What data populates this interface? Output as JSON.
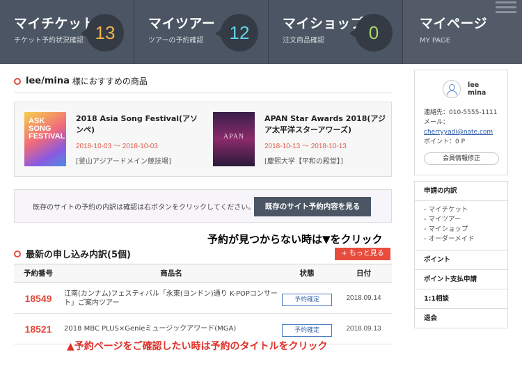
{
  "nav": [
    {
      "title": "マイチケット",
      "sub": "チケット予約状況確認",
      "count": "13"
    },
    {
      "title": "マイツアー",
      "sub": "ツアーの予約確認",
      "count": "12"
    },
    {
      "title": "マイショップ",
      "sub": "注文商品確認",
      "count": "0"
    },
    {
      "title": "マイページ",
      "sub": "MY PAGE"
    }
  ],
  "recommend": {
    "user": "lee/mina",
    "suffix": "様におすすめの商品",
    "items": [
      {
        "poster_text": "ASK SONG FESTIVAL",
        "name": "2018 Asia Song Festival(アソンペ)",
        "date": "2018-10-03 ～ 2018-10-03",
        "venue": "[釜山アジアードメイン競技場]"
      },
      {
        "poster_text": "APAN",
        "name": "APAN Star Awards 2018(アジア太平洋スターアワーズ)",
        "date": "2018-10-13 ～ 2018-10-13",
        "venue": "[慶熙大学【平和の殿堂】]"
      }
    ]
  },
  "notice": {
    "text": "既存のサイトの予約の内訳は確認は右ボタンをクリックしてください。",
    "button": "既存のサイト予約内容を見る"
  },
  "annotation_top": "予約が見つからない時は▼をクリック",
  "recent": {
    "title": "最新の申し込み内訳(5個)",
    "more": "+ もっと見る",
    "headers": [
      "予約番号",
      "商品名",
      "状態",
      "日付"
    ],
    "rows": [
      {
        "no": "18549",
        "title": "江南(カンナム)フェスティバル「永東(ヨンドン)通り K-POPコンサート」ご案内ツアー",
        "status": "予約確定",
        "date": "2018.09.14"
      },
      {
        "no": "18521",
        "title": "2018 MBC PLUS×Genieミュージックアワード(MGA)",
        "status": "予約確定",
        "date": "2018.09.13"
      }
    ]
  },
  "annotation_bottom": "▲予約ページをご確認したい時は予約のタイトルをクリック",
  "profile": {
    "name_line1": "lee",
    "name_line2": "mina",
    "phone": "連絡先：010-5555-1111",
    "mail_label": "メール：",
    "email": "cherryyadi@nate.com",
    "points": "ポイント：0 P",
    "edit": "会員情報修正"
  },
  "sidebar": {
    "apply_head": "申請の内訳",
    "apply_items": [
      "- マイチケット",
      "- マイツアー",
      "- マイショップ",
      "- オーダーメイド"
    ],
    "links": [
      "ポイント",
      "ポイント支払申請",
      "1:1相談",
      "退会"
    ]
  }
}
